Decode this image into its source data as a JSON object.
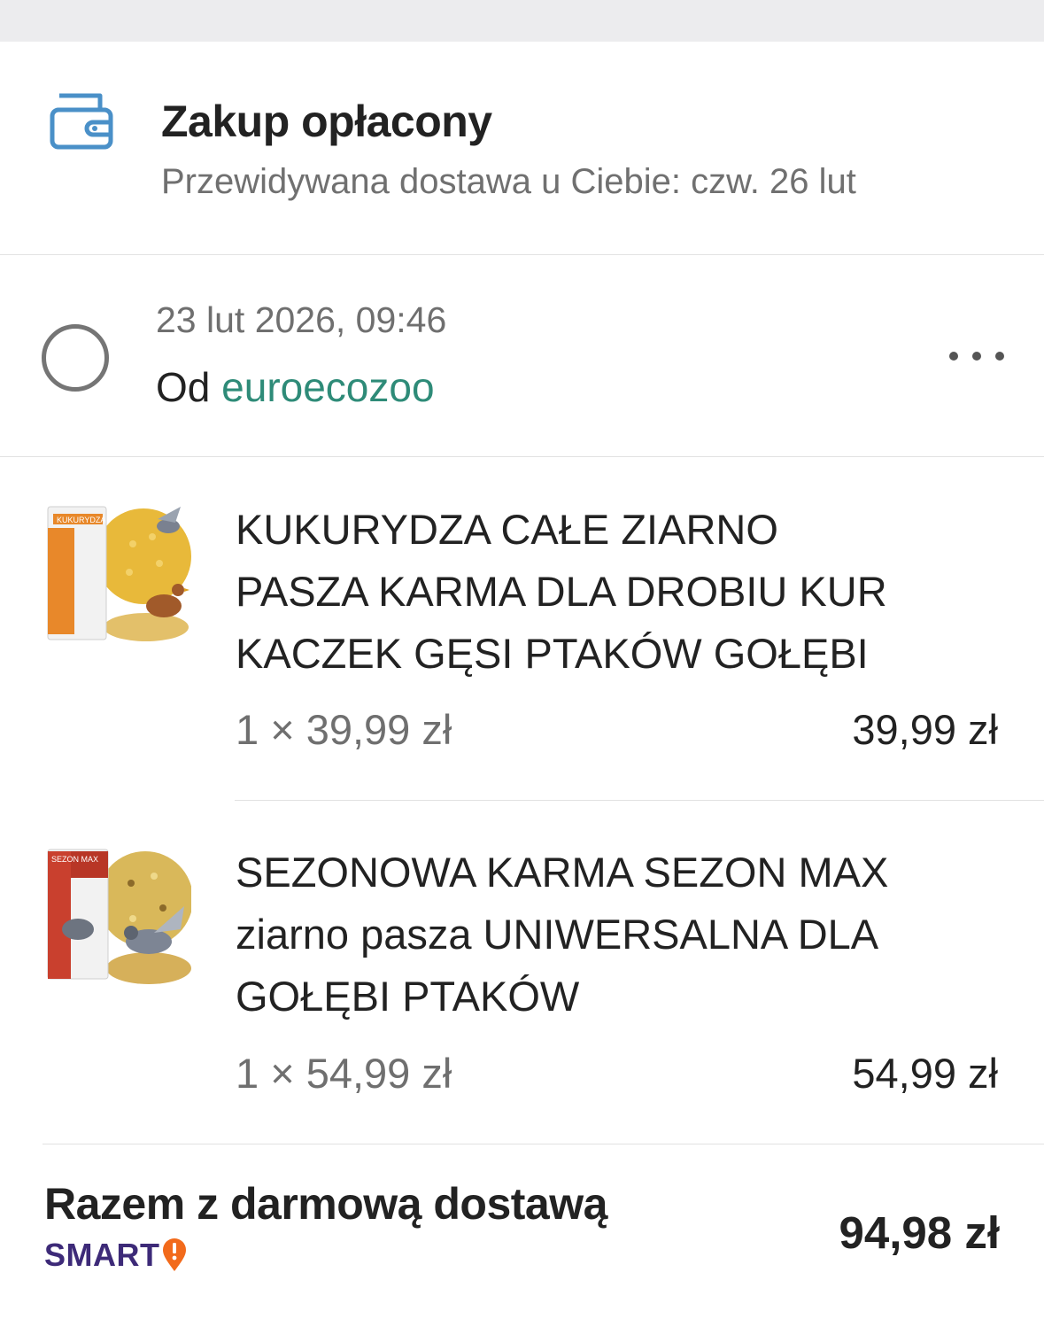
{
  "status": {
    "icon": "wallet-icon",
    "title": "Zakup opłacony",
    "delivery": "Przewidywana dostawa u Ciebie: czw. 26 lut"
  },
  "order": {
    "date": "23 lut 2026, 09:46",
    "from_label": "Od",
    "seller": "euroecozoo",
    "more_icon": "more-horizontal-icon"
  },
  "items": [
    {
      "line1": "KUKURYDZA CAŁE ZIARNO",
      "line2": "PASZA KARMA DLA DROBIU KUR",
      "line3": "KACZEK GĘSI PTAKÓW GOŁĘBI",
      "qty_price": "1 × 39,99 zł",
      "total": "39,99 zł",
      "image": "corn-feed-bag-image"
    },
    {
      "line1": "SEZONOWA KARMA SEZON MAX",
      "line2": "ziarno pasza UNIWERSALNA DLA",
      "line3": "GOŁĘBI PTAKÓW",
      "qty_price": "1 × 54,99 zł",
      "total": "54,99 zł",
      "image": "seasonal-feed-bag-image"
    }
  ],
  "summary": {
    "label": "Razem z darmową dostawą",
    "badge": "SMART",
    "total": "94,98 zł"
  },
  "colors": {
    "accent_green": "#2e8b78",
    "icon_blue": "#4a90c8",
    "smart_purple": "#3d2a78",
    "smart_orange": "#f26a1b"
  }
}
